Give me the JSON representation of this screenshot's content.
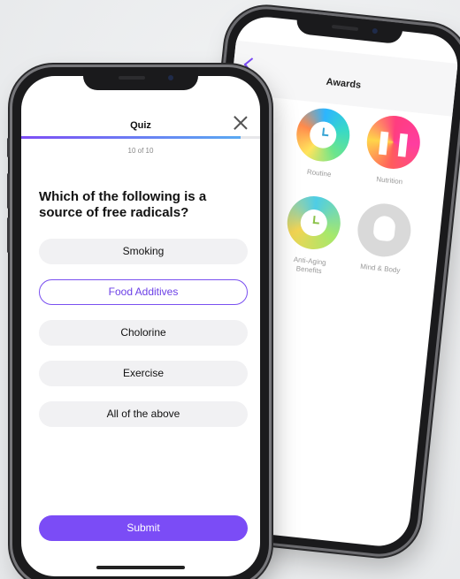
{
  "awards_screen": {
    "title": "Awards",
    "back_icon": "chevron-left-icon",
    "items": [
      {
        "label": "Routine",
        "icon": "clock-icon"
      },
      {
        "label": "Nutrition",
        "icon": "fork-knife-icon"
      },
      {
        "label": "Anti-Aging\nBenefits",
        "icon": "clock-icon"
      },
      {
        "label": "Mind & Body",
        "icon": "head-icon"
      }
    ]
  },
  "quiz_screen": {
    "title": "Quiz",
    "close_icon": "close-icon",
    "progress": {
      "text": "10 of 10",
      "fraction": 0.92
    },
    "question": "Which of the following is a source of free radicals?",
    "options": [
      {
        "label": "Smoking",
        "selected": false
      },
      {
        "label": "Food Additives",
        "selected": true
      },
      {
        "label": "Cholorine",
        "selected": false
      },
      {
        "label": "Exercise",
        "selected": false
      },
      {
        "label": "All of the above",
        "selected": false
      }
    ],
    "submit_label": "Submit",
    "accent_color": "#7b4cf6"
  }
}
